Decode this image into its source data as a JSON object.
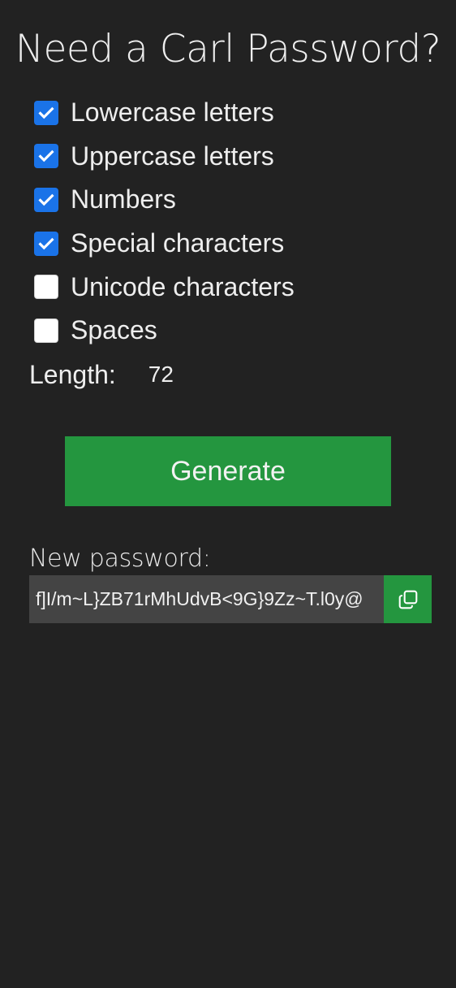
{
  "title": "Need a Carl Password?",
  "options": [
    {
      "label": "Lowercase letters",
      "checked": true
    },
    {
      "label": "Uppercase letters",
      "checked": true
    },
    {
      "label": "Numbers",
      "checked": true
    },
    {
      "label": "Special characters",
      "checked": true
    },
    {
      "label": "Unicode characters",
      "checked": false
    },
    {
      "label": "Spaces",
      "checked": false
    }
  ],
  "length": {
    "label": "Length:",
    "value": "72"
  },
  "generate_label": "Generate",
  "new_password": {
    "label": "New password:",
    "value": "f]I/m~L}ZB71rMhUdvB<9G}9Zz~T.l0y@"
  },
  "icons": {
    "checkbox_checked": "check-icon",
    "copy": "copy-icon"
  },
  "colors": {
    "background": "#222222",
    "accent_green": "#24963f",
    "checkbox_blue": "#1a73e8",
    "field_bg": "#444444"
  }
}
